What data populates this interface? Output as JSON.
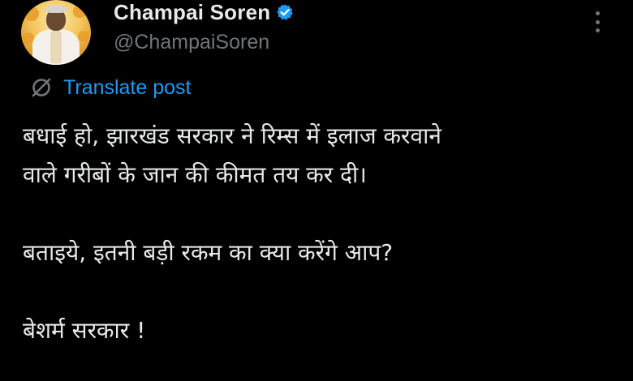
{
  "post": {
    "author": {
      "display_name": "Champai Soren",
      "handle": "@ChampaiSoren",
      "verified": true,
      "avatar": "profile-photo"
    },
    "translate_label": "Translate post",
    "text_lines": [
      "बधाई हो, झारखंड सरकार ने रिम्स में इलाज करवाने",
      "वाले गरीबों के जान की कीमत तय कर दी।",
      "",
      "बताइये, इतनी बड़ी रकम का क्या करेंगे आप?",
      "",
      "बेशर्म सरकार !"
    ]
  },
  "icons": {
    "verified": "verified-badge-icon",
    "translate": "globe-translate-icon",
    "more": "more-options-icon"
  },
  "colors": {
    "background": "#000000",
    "primary_text": "#e7e9ea",
    "secondary_text": "#71767b",
    "accent": "#1d9bf0"
  }
}
